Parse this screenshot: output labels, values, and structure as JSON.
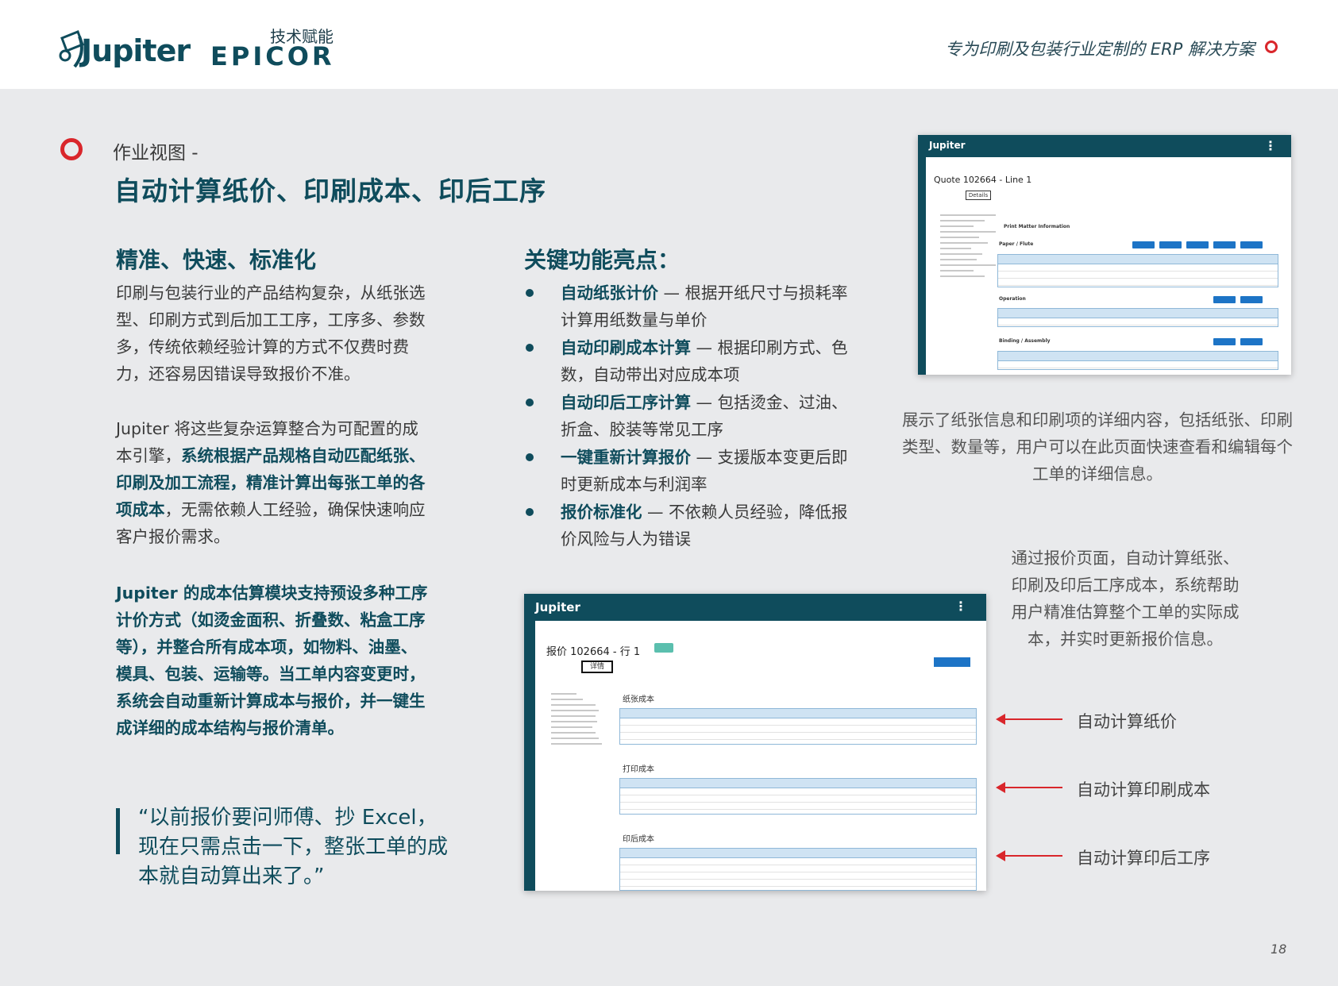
{
  "header": {
    "jupiter_logo": "Jupiter",
    "epicor_sub": "技术赋能",
    "epicor_logo": "EPICOR",
    "tagline": "专为印刷及包装行业定制的 ERP 解决方案"
  },
  "section": {
    "subtitle": "作业视图 -",
    "title": "自动计算纸价、印刷成本、印后工序"
  },
  "left": {
    "heading": "精准、快速、标准化",
    "p1": "印刷与包装行业的产品结构复杂，从纸张选型、印刷方式到后加工工序，工序多、参数多，传统依赖经验计算的方式不仅费时费力，还容易因错误导致报价不准。",
    "p2_start": "Jupiter 将这些复杂运算整合为可配置的成本引擎，",
    "p2_bold": "系统根据产品规格自动匹配纸张、印刷及加工流程，精准计算出每张工单的各项成本",
    "p2_end": "，无需依赖人工经验，确保快速响应客户报价需求。",
    "p3": "Jupiter 的成本估算模块支持预设多种工序计价方式（如烫金面积、折叠数、粘盒工序等），并整合所有成本项，如物料、油墨、模具、包装、运输等。当工单内容变更时，系统会自动重新计算成本与报价，并一键生成详细的成本结构与报价清单。",
    "quote": "“以前报价要问师傅、抄 Excel，现在只需点击一下，整张工单的成本就自动算出来了。”"
  },
  "middle": {
    "heading": "关键功能亮点：",
    "features": [
      {
        "title": "自动纸张计价",
        "desc": " — 根据开纸尺寸与损耗率计算用纸数量与单价"
      },
      {
        "title": "自动印刷成本计算",
        "desc": " — 根据印刷方式、色数，自动带出对应成本项"
      },
      {
        "title": "自动印后工序计算",
        "desc": " — 包括烫金、过油、折盒、胶装等常见工序"
      },
      {
        "title": "一键重新计算报价",
        "desc": " — 支援版本变更后即时更新成本与利润率"
      },
      {
        "title": "报价标准化",
        "desc": " — 不依赖人员经验，降低报价风险与人为错误"
      }
    ]
  },
  "shot_top": {
    "brand": "Jupiter",
    "quote_title": "Quote 102664 - Line 1",
    "tab_details": "Details",
    "sec_print": "Print Matter Information",
    "sec_paper": "Paper / Flute",
    "sec_operation": "Operation",
    "sec_binding": "Binding / Assembly"
  },
  "shot_bottom": {
    "brand": "Jupiter",
    "quote_title": "报价 102664 - 行 1",
    "tab_details": "详情",
    "sec_paper": "纸张成本",
    "sec_print": "打印成本",
    "sec_post": "印后成本"
  },
  "captions": {
    "cap1": "展示了纸张信息和印刷项的详细内容，包括纸张、印刷类型、数量等，用户可以在此页面快速查看和编辑每个工单的详细信息。",
    "cap2": "通过报价页面，自动计算纸张、印刷及印后工序成本，系统帮助用户精准估算整个工单的实际成本，并实时更新报价信息。"
  },
  "arrows": [
    "自动计算纸价",
    "自动计算印刷成本",
    "自动计算印后工序"
  ],
  "page_number": "18",
  "colors": {
    "brand": "#0f4c5c",
    "accent": "#d9262b"
  }
}
